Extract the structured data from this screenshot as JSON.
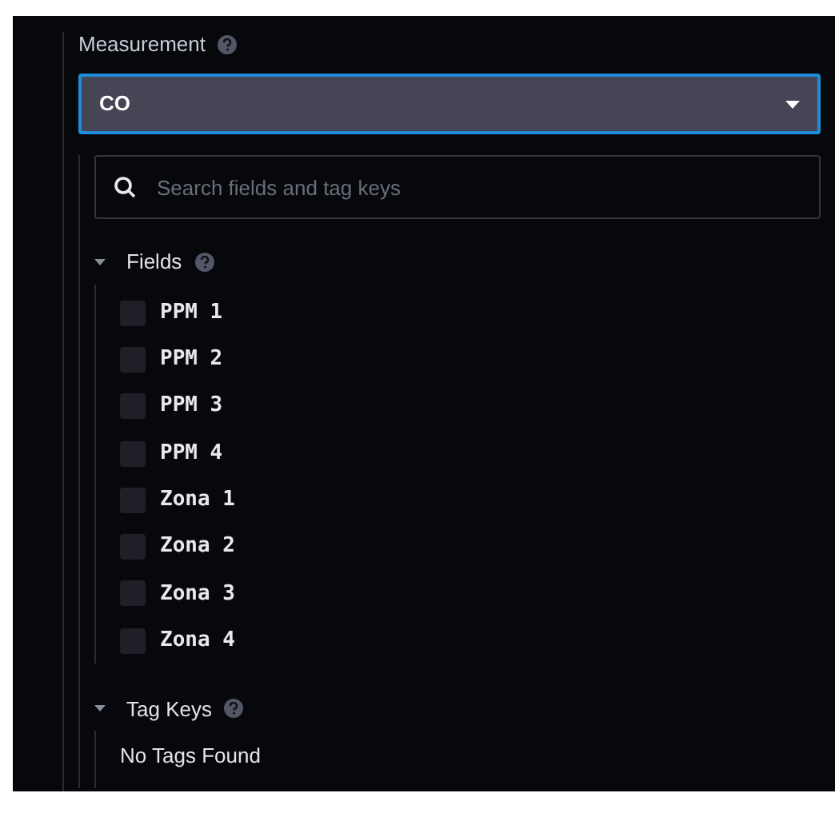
{
  "measurement": {
    "label": "Measurement",
    "value": "CO"
  },
  "search": {
    "placeholder": "Search fields and tag keys"
  },
  "fields": {
    "label": "Fields",
    "expanded": true,
    "items": [
      {
        "label": "PPM 1",
        "checked": false
      },
      {
        "label": "PPM 2",
        "checked": false
      },
      {
        "label": "PPM 3",
        "checked": false
      },
      {
        "label": "PPM 4",
        "checked": false
      },
      {
        "label": "Zona 1",
        "checked": false
      },
      {
        "label": "Zona 2",
        "checked": false
      },
      {
        "label": "Zona 3",
        "checked": false
      },
      {
        "label": "Zona 4",
        "checked": false
      }
    ]
  },
  "tag_keys": {
    "label": "Tag Keys",
    "expanded": true,
    "empty_text": "No Tags Found"
  }
}
